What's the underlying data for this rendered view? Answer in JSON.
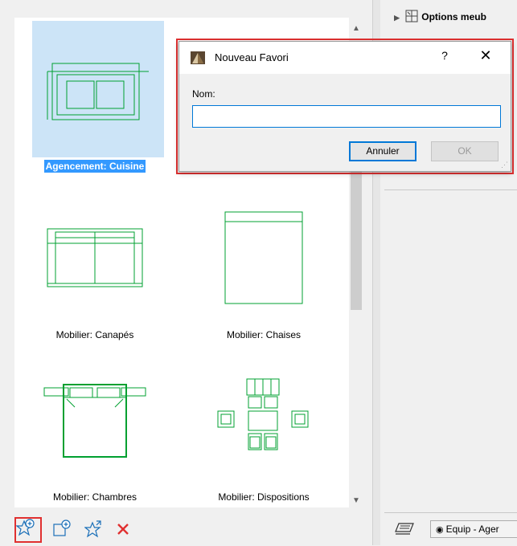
{
  "favorites": {
    "items": [
      {
        "label": "Agencement: Cuisine",
        "selected": true,
        "icon": "kitchen-layout-icon"
      },
      {
        "label": "Mobilier: Canapés",
        "selected": false,
        "icon": "sofa-icon"
      },
      {
        "label": "Mobilier: Chaises",
        "selected": false,
        "icon": "chair-icon"
      },
      {
        "label": "Mobilier: Chambres",
        "selected": false,
        "icon": "bed-icon"
      },
      {
        "label": "Mobilier: Dispositions",
        "selected": false,
        "icon": "dining-arrangement-icon"
      }
    ]
  },
  "toolbar": {
    "icons": [
      "new-favorite-icon",
      "new-favorite-from-selection-icon",
      "redefine-favorite-icon",
      "delete-icon"
    ]
  },
  "right_panel": {
    "top_item": "Options meub",
    "view_button": "Equip - Ager"
  },
  "dialog": {
    "title": "Nouveau Favori",
    "help": "?",
    "close": "✕",
    "name_label": "Nom:",
    "name_value": "",
    "cancel_label": "Annuler",
    "ok_label": "OK"
  },
  "colors": {
    "plan_symbol": "#00a030",
    "selection": "#3399ff",
    "highlight_outline": "#e03030",
    "delete": "#e03030"
  }
}
